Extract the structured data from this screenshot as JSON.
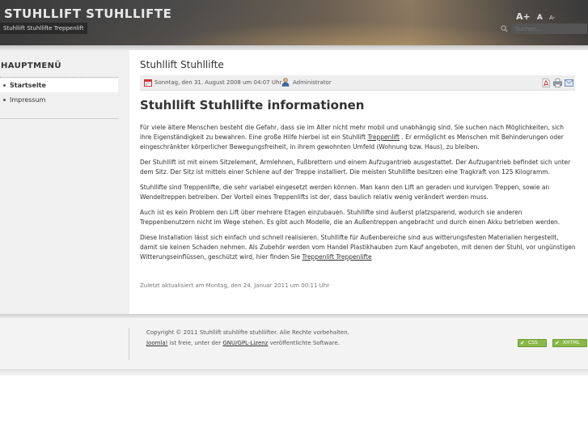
{
  "header": {
    "site_title": "STUHLLIFT STUHLLIFTE",
    "tagline": "Stuhllift Stuhllifte Treppenlift",
    "font_size_tools": {
      "increase": "A+",
      "reset": "A",
      "decrease": "A-"
    },
    "search_placeholder": "Suchen...",
    "search_icon": "search-icon"
  },
  "sidebar": {
    "title": "HAUPTMENÜ",
    "items": [
      {
        "label": "Startseite",
        "active": true
      },
      {
        "label": "Impressum",
        "active": false
      }
    ]
  },
  "article": {
    "header_title": "Stuhllift Stuhllifte",
    "meta": {
      "date": "Sonntag, den 31. August 2008 um 04:07 Uhr",
      "author": "Administrator",
      "icons": [
        "calendar-icon",
        "user-icon",
        "pdf-icon",
        "print-icon",
        "email-icon"
      ]
    },
    "title": "Stuhllift Stuhllifte informationen",
    "p1": "Für viele ältere Menschen besteht die Gefahr, dass sie im Alter nicht mehr mobil und unabhängig sind. Sie suchen nach Möglichkeiten, sich ihre Eigenständigkeit zu bewahren. Eine große Hilfe hierbei ist ein Stuhllift ",
    "p1_link": "Treppenlift",
    "p1_tail": " . Er ermöglicht es Menschen mit Behinderungen oder eingeschränkter körperlicher Bewegungsfreiheit, in ihrem gewohnten Umfeld (Wohnung bzw. Haus), zu bleiben.",
    "p2": "Der Stuhllift ist mit einem Sitzelement, Armlehnen, Fußbrettern und einem Aufzugantrieb ausgestattet. Der Aufzugantrieb befindet sich unter dem Sitz. Der Sitz ist mittels einer Schiene auf der Treppe installiert. Die meisten Stuhllifte besitzen eine Tragkraft von 125 Kilogramm.",
    "p3": "Stuhllifte sind Treppenlifte, die sehr variabel eingesetzt werden können. Man kann den Lift an geraden und kurvigen Treppen, sowie an Wendeltreppen betreiben. Der Vorteil eines Treppenlifts ist der, dass baulich relativ wenig verändert werden muss.",
    "p4": "Auch ist es kein Problem den Lift über mehrere Etagen einzubauen. Stuhllifte sind äußerst platzsparend, wodurch sie anderen Treppenbenutzern nicht im Wege stehen. Es gibt auch Modelle, die an Außentreppen angebracht und durch einen Akku betrieben werden.",
    "p5": "Diese Installation lässt sich einfach und schnell realisieren. Stuhllifte für Außenbereiche sind aus witterungsfesten Materialien hergestellt, damit sie keinen Schaden nehmen. Als Zubehör werden vom Handel Plastikhauben zum Kauf angeboten, mit denen der Stuhl, vor ungünstigen Witterungseinflüssen, geschützt wird, hier finden Sie ",
    "p5_link": "Treppenlift Treppenlifte",
    "last_modified": "Zuletzt aktualisiert am Montag, den 24. Januar 2011 um 00:11 Uhr"
  },
  "footer": {
    "copyright": "Copyright © 2011 Stuhllift stuhllifte stuhllifter. Alle Rechte vorbehalten.",
    "joomla_link": "Joomla!",
    "joomla_mid": " ist freie, unter der ",
    "license_link": "GNU/GPL-Lizenz",
    "joomla_tail": " veröffentlichte Software.",
    "badges": [
      {
        "label": "CSS",
        "icon": "check-icon"
      },
      {
        "label": "XHTML",
        "icon": "check-icon"
      }
    ],
    "badge_color": "#8ab848"
  }
}
